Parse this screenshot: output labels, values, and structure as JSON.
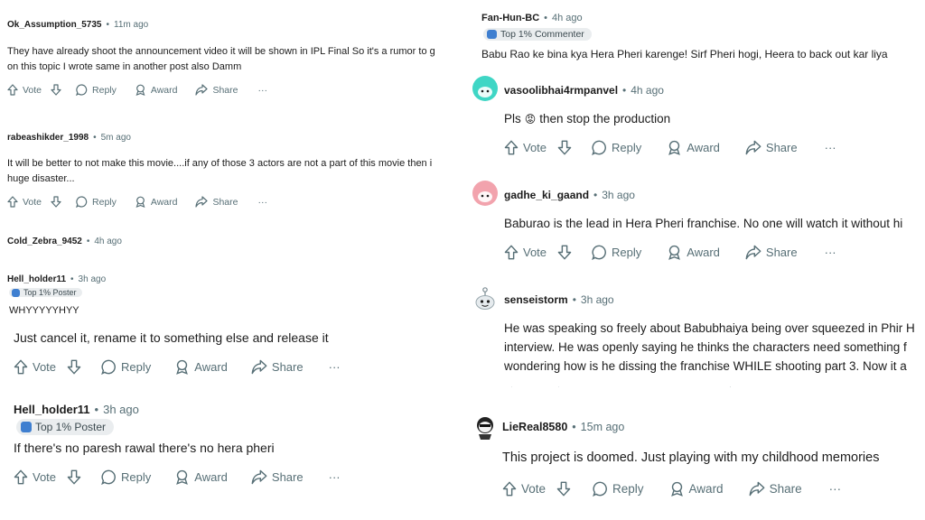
{
  "left": {
    "comments": [
      {
        "user": "Ok_Assumption_5735",
        "time": "11m ago",
        "lines": [
          "They have already shoot the announcement video it will be shown in IPL Final So it's a rumor to g",
          "on this topic I wrote same in another post also Damm"
        ],
        "actions": {
          "vote": "Vote",
          "reply": "Reply",
          "award": "Award",
          "share": "Share",
          "more": "···"
        }
      },
      {
        "user": "rabeashikder_1998",
        "time": "5m ago",
        "lines": [
          "It will be better to not make this movie....if any of those 3 actors are not a part of this movie then i",
          "huge disaster..."
        ],
        "actions": {
          "vote": "Vote",
          "reply": "Reply",
          "award": "Award",
          "share": "Share",
          "more": "···"
        }
      },
      {
        "user": "Cold_Zebra_9452",
        "time": "4h ago"
      },
      {
        "user": "Hell_holder11",
        "time": "3h ago",
        "badge": "Top 1% Poster",
        "lines": [
          "WHYYYYYHYY"
        ]
      },
      {
        "lines": [
          "Just cancel it, rename it to something else and release it"
        ],
        "actions": {
          "vote": "Vote",
          "reply": "Reply",
          "award": "Award",
          "share": "Share",
          "more": "···"
        }
      },
      {
        "user": "Hell_holder11",
        "time": "3h ago",
        "badge": "Top 1% Poster",
        "lines": [
          "If there's no paresh rawal there's no hera pheri"
        ],
        "actions": {
          "vote": "Vote",
          "reply": "Reply",
          "award": "Award",
          "share": "Share",
          "more": "···"
        }
      }
    ]
  },
  "right": {
    "comments": [
      {
        "user": "Fan-Hun-BC",
        "time": "4h ago",
        "badge": "Top 1% Commenter",
        "lines": [
          "Babu Rao ke bina kya Hera Pheri karenge! Sirf Pheri hogi, Heera to back out kar liya"
        ]
      },
      {
        "user": "vasoolibhai4rmpanvel",
        "time": "4h ago",
        "text_before": "Pls",
        "emoji": "😡",
        "text_after": "then stop the production",
        "actions": {
          "vote": "Vote",
          "reply": "Reply",
          "award": "Award",
          "share": "Share",
          "more": "···"
        }
      },
      {
        "user": "gadhe_ki_gaand",
        "time": "3h ago",
        "lines": [
          "Baburao is the lead in Hera Pheri franchise. No one will watch it without hi"
        ],
        "actions": {
          "vote": "Vote",
          "reply": "Reply",
          "award": "Award",
          "share": "Share",
          "more": "···"
        }
      },
      {
        "user": "senseistorm",
        "time": "3h ago",
        "lines": [
          "He was speaking so freely about Babubhaiya being over squeezed in Phir H",
          "interview. He was openly saying he thinks the characters need something f",
          "wondering how is he dissing the franchise WHILE shooting part 3. Now it a"
        ]
      },
      {
        "user": "LieReal8580",
        "time": "15m ago",
        "lines": [
          "This project is doomed. Just playing with my childhood memories"
        ],
        "actions": {
          "vote": "Vote",
          "reply": "Reply",
          "award": "Award",
          "share": "Share",
          "more": "···"
        }
      }
    ]
  },
  "colors": {
    "text": "#1c1c1c",
    "meta": "#576f76",
    "badge_bg": "#eaedef",
    "badge_icon": "#3f7fd0",
    "avatar_teal": "#3fd6c5",
    "avatar_pink": "#f2a3ad"
  }
}
